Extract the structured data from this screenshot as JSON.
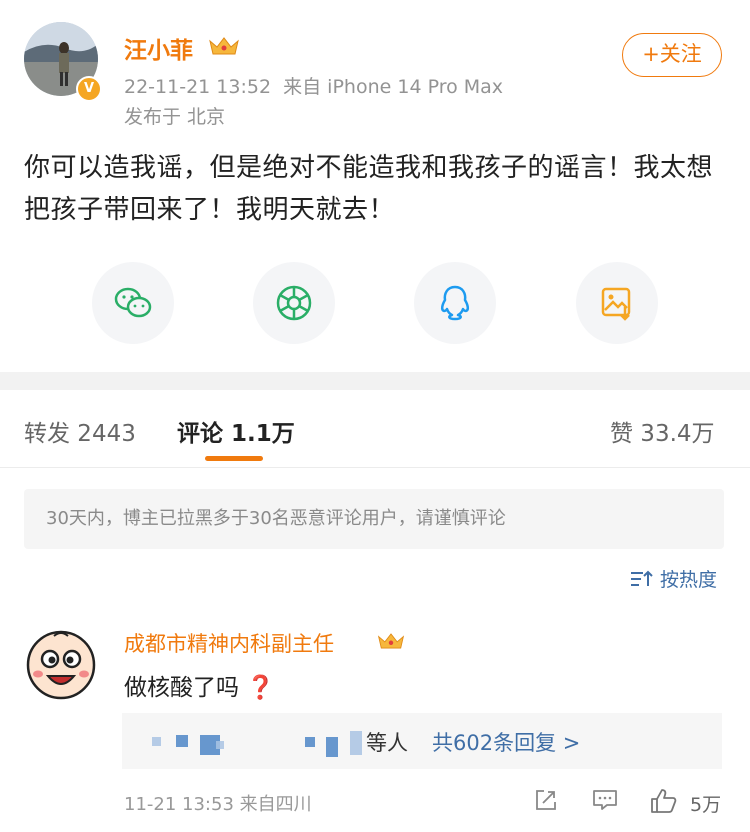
{
  "post": {
    "username": "汪小菲",
    "verified_badge": "V",
    "time": "22-11-21 13:52",
    "source": "来自 iPhone 14 Pro Max",
    "location": "发布于 北京",
    "follow_label": "+关注",
    "text": "你可以造我谣，但是绝对不能造我和我孩子的谣言！我太想把孩子带回来了！我明天就去！"
  },
  "share_icons": [
    "wechat-icon",
    "moments-icon",
    "qq-icon",
    "save-image-icon"
  ],
  "tabs": {
    "repost": "转发 2443",
    "comments": "评论 1.1万",
    "likes": "赞 33.4万"
  },
  "notice": "30天内，博主已拉黑多于30名恶意评论用户，请谨慎评论",
  "sort_label": "按热度",
  "comment": {
    "username": "成都市精神内科副主任",
    "text": "做核酸了吗",
    "emoji": "❓",
    "reply_who_suffix": "等人",
    "reply_more": "共602条回复 >",
    "meta": "11-21 13:53 来自四川",
    "likes": "5万"
  },
  "colors": {
    "accent": "#f07a0e",
    "link": "#3f6ea6",
    "wechat": "#2aae67",
    "qq": "#1d9bf0",
    "save": "#f5a623"
  }
}
